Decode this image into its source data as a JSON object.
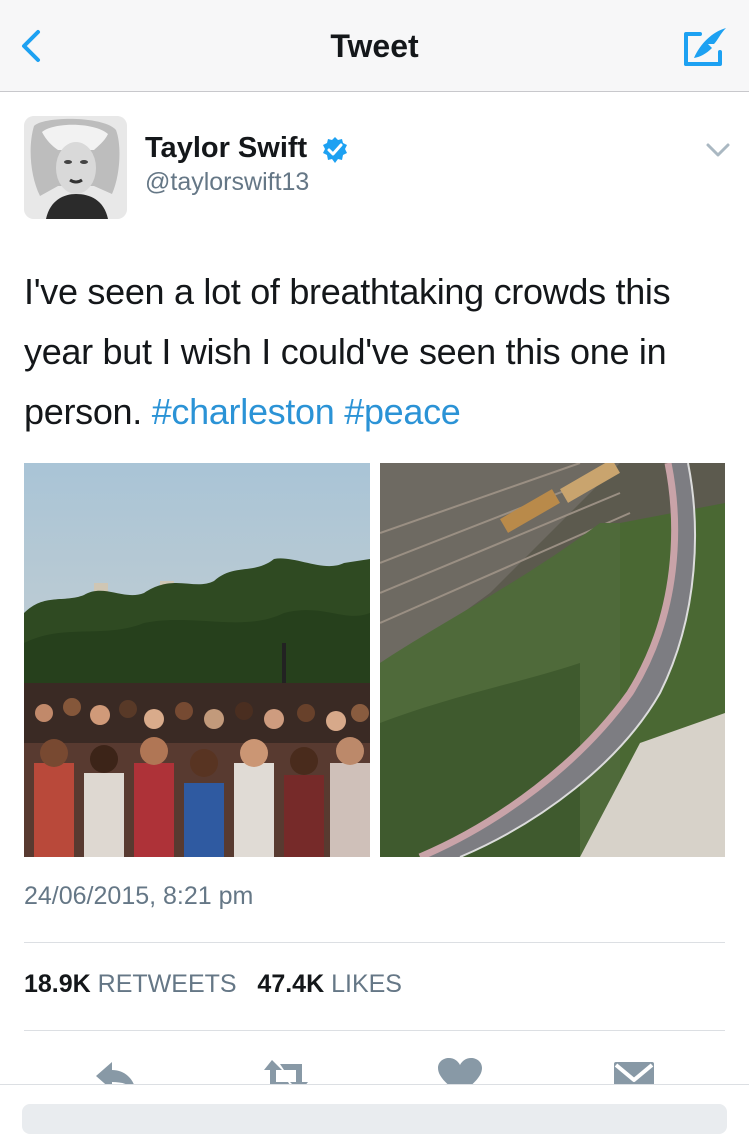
{
  "nav": {
    "title": "Tweet",
    "back_icon": "chevron-left-icon",
    "compose_icon": "compose-tweet-icon"
  },
  "author": {
    "name": "Taylor Swift",
    "handle": "@taylorswift13",
    "verified": true,
    "verified_icon": "verified-badge-icon"
  },
  "tweet": {
    "text_parts": [
      "I've seen a lot of breathtaking crowds this year but I wish I could've seen this one in person. "
    ],
    "hashtags": [
      "#charleston",
      "#peace"
    ],
    "timestamp": "24/06/2015, 8:21 pm",
    "media": [
      {
        "description_icon": "crowd-photo"
      },
      {
        "description_icon": "aerial-bridge-photo"
      }
    ]
  },
  "stats": {
    "retweets_count": "18.9K",
    "retweets_label": "RETWEETS",
    "likes_count": "47.4K",
    "likes_label": "LIKES"
  },
  "actions": [
    "reply-icon",
    "retweet-icon",
    "like-heart-icon",
    "direct-message-icon"
  ],
  "colors": {
    "link": "#2b93d6",
    "muted": "#657786",
    "text": "#14171a",
    "verified": "#1da1f2",
    "action_icon": "#8899a6"
  }
}
